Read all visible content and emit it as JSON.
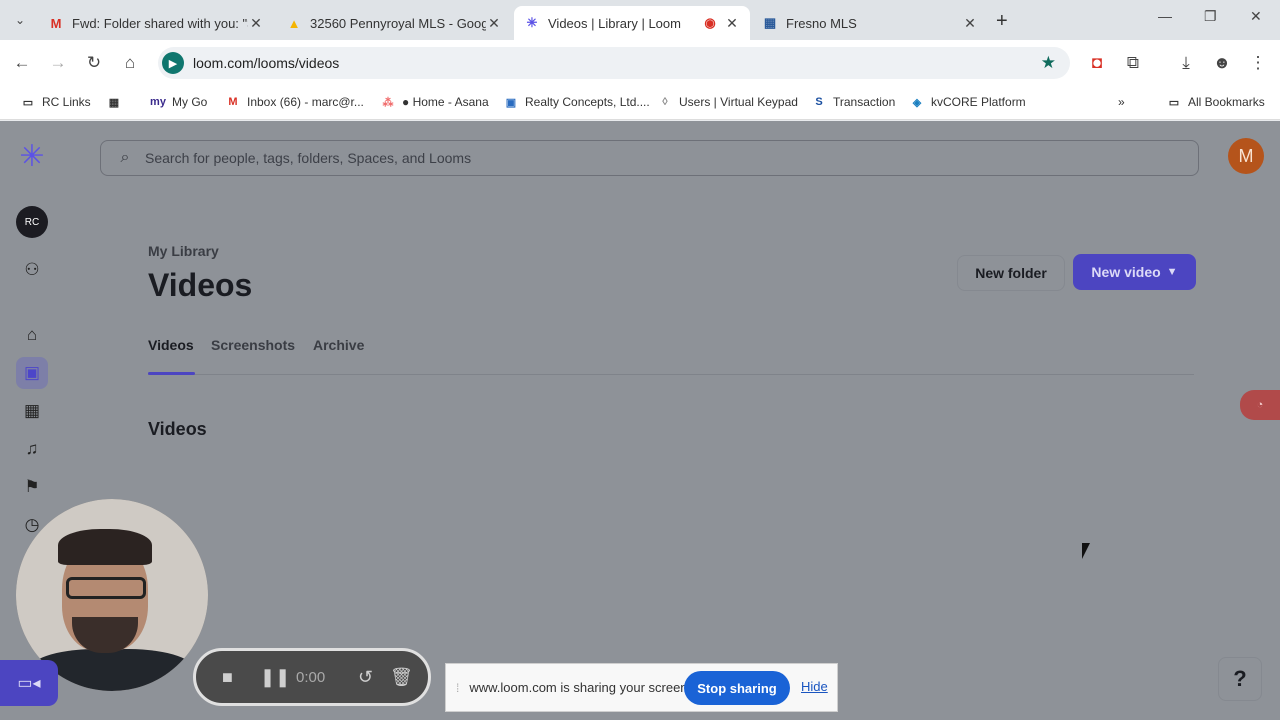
{
  "browser": {
    "tabs": [
      {
        "title": "Fwd: Folder shared with you: \"3",
        "icon": "gmail-icon",
        "active": false
      },
      {
        "title": "32560 Pennyroyal MLS - Googl",
        "icon": "google-drive-icon",
        "active": false
      },
      {
        "title": "Videos | Library | Loom",
        "icon": "loom-icon",
        "active": true
      },
      {
        "title": "Fresno MLS",
        "icon": "mls-icon",
        "active": false
      }
    ],
    "url": "loom.com/looms/videos",
    "bookmarks": [
      {
        "label": "RC Links"
      },
      {
        "label": "My Go"
      },
      {
        "label": "Inbox (66) - marc@r..."
      },
      {
        "label": "● Home - Asana"
      },
      {
        "label": "Realty Concepts, Ltd...."
      },
      {
        "label": "Users | Virtual Keypad"
      },
      {
        "label": "Transaction"
      },
      {
        "label": "kvCORE Platform"
      }
    ],
    "all_bookmarks_label": "All Bookmarks"
  },
  "app": {
    "workspace_initials": "RC",
    "search_placeholder": "Search for people, tags, folders, Spaces, and Looms",
    "user_initial": "M",
    "breadcrumb": "My Library",
    "page_title": "Videos",
    "new_folder_label": "New folder",
    "new_video_label": "New video",
    "tabs": [
      "Videos",
      "Screenshots",
      "Archive"
    ],
    "section_title": "Videos",
    "accent_color": "#4c45c1"
  },
  "recorder": {
    "timer": "0:00"
  },
  "share_bar": {
    "message": "www.loom.com is sharing your screen.",
    "stop_label": "Stop sharing",
    "hide_label": "Hide"
  },
  "help_label": "?"
}
